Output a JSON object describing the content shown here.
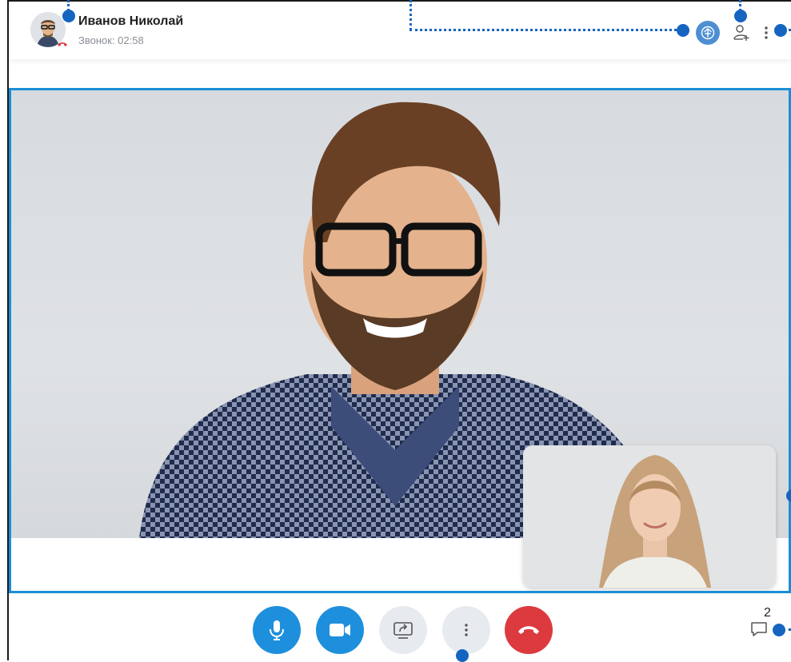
{
  "header": {
    "callee_name": "Иванов Николай",
    "call_timer": "Звонок: 02:58"
  },
  "icons": {
    "avatar": "avatar-with-phone-badge",
    "encryption": "encryption-icon",
    "add_participant": "add-user-icon",
    "more": "more-vertical-icon",
    "microphone": "microphone-icon",
    "camera": "video-camera-icon",
    "screen_share": "screen-share-icon",
    "hangup": "hangup-icon",
    "chat": "chat-icon"
  },
  "chat": {
    "count": "2"
  },
  "colors": {
    "accent": "#1e8fdc",
    "hangup": "#dc3a3f",
    "secondary_button": "#e7ebf0",
    "annotation": "#1565c0",
    "video_border": "#1a8fd6"
  }
}
